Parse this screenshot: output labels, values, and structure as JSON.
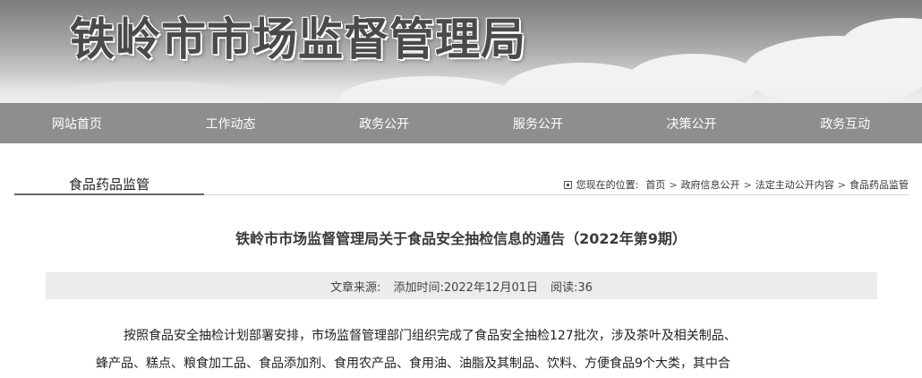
{
  "header": {
    "site_title": "铁岭市市场监督管理局"
  },
  "nav": {
    "items": [
      "网站首页",
      "工作动态",
      "政务公开",
      "服务公开",
      "决策公开",
      "政务互动"
    ]
  },
  "section": {
    "tab_label": "食品药品监管"
  },
  "breadcrumb": {
    "prefix": "您现在的位置:",
    "items": [
      "首页",
      "政府信息公开",
      "法定主动公开内容",
      "食品药品监管"
    ],
    "separator": ">"
  },
  "article": {
    "title": "铁岭市市场监督管理局关于食品安全抽检信息的通告（2022年第9期）",
    "meta": {
      "source_label": "文章来源:",
      "added_time": "添加时间:2022年12月01日",
      "reads": "阅读:36"
    },
    "body_lines": [
      "按照食品安全抽检计划部署安排，市场监督管理部门组织完成了食品安全抽检127批次，涉及茶叶及相关制品、",
      "蜂产品、糕点、粮食加工品、食品添加剂、食用农产品、食用油、油脂及其制品、饮料、方便食品9个大类，其中合"
    ]
  },
  "colors": {
    "nav_background": "#8e8e8e",
    "meta_background": "#ececec"
  }
}
